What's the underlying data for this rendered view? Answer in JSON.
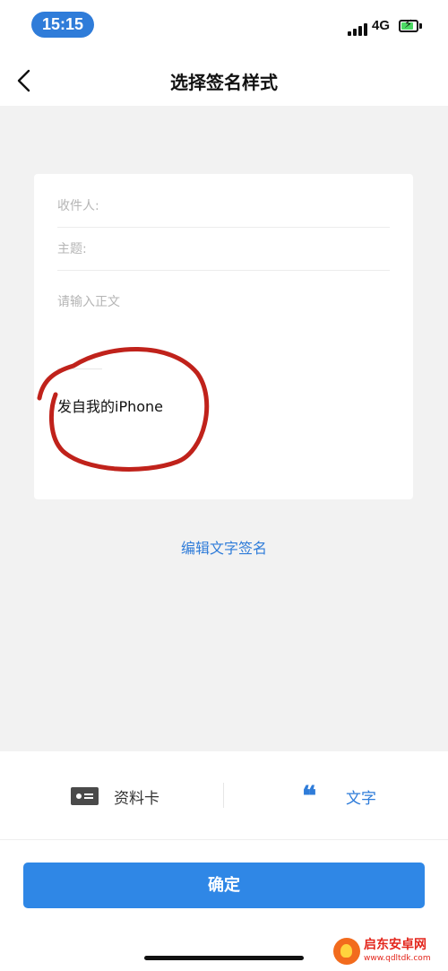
{
  "status_bar": {
    "time": "15:15",
    "network": "4G",
    "icons": [
      "signal-icon",
      "battery-charging-icon"
    ]
  },
  "nav": {
    "title": "选择签名样式",
    "back_icon": "chevron-left-icon"
  },
  "preview": {
    "to_label": "收件人:",
    "subject_label": "主题:",
    "body_placeholder": "请输入正文",
    "signature": "发自我的iPhone",
    "annotation_color": "#c0221b"
  },
  "edit_link": "编辑文字签名",
  "tabs": [
    {
      "label": "资料卡",
      "icon": "id-card-icon",
      "active": false
    },
    {
      "label": "文字",
      "icon": "quote-icon",
      "active": true
    }
  ],
  "confirm_label": "确定",
  "watermark": {
    "name": "启东安卓网",
    "url": "www.qdltdk.com"
  },
  "colors": {
    "accent": "#2f7cd9",
    "button": "#2f87e6",
    "background": "#f2f2f2"
  }
}
